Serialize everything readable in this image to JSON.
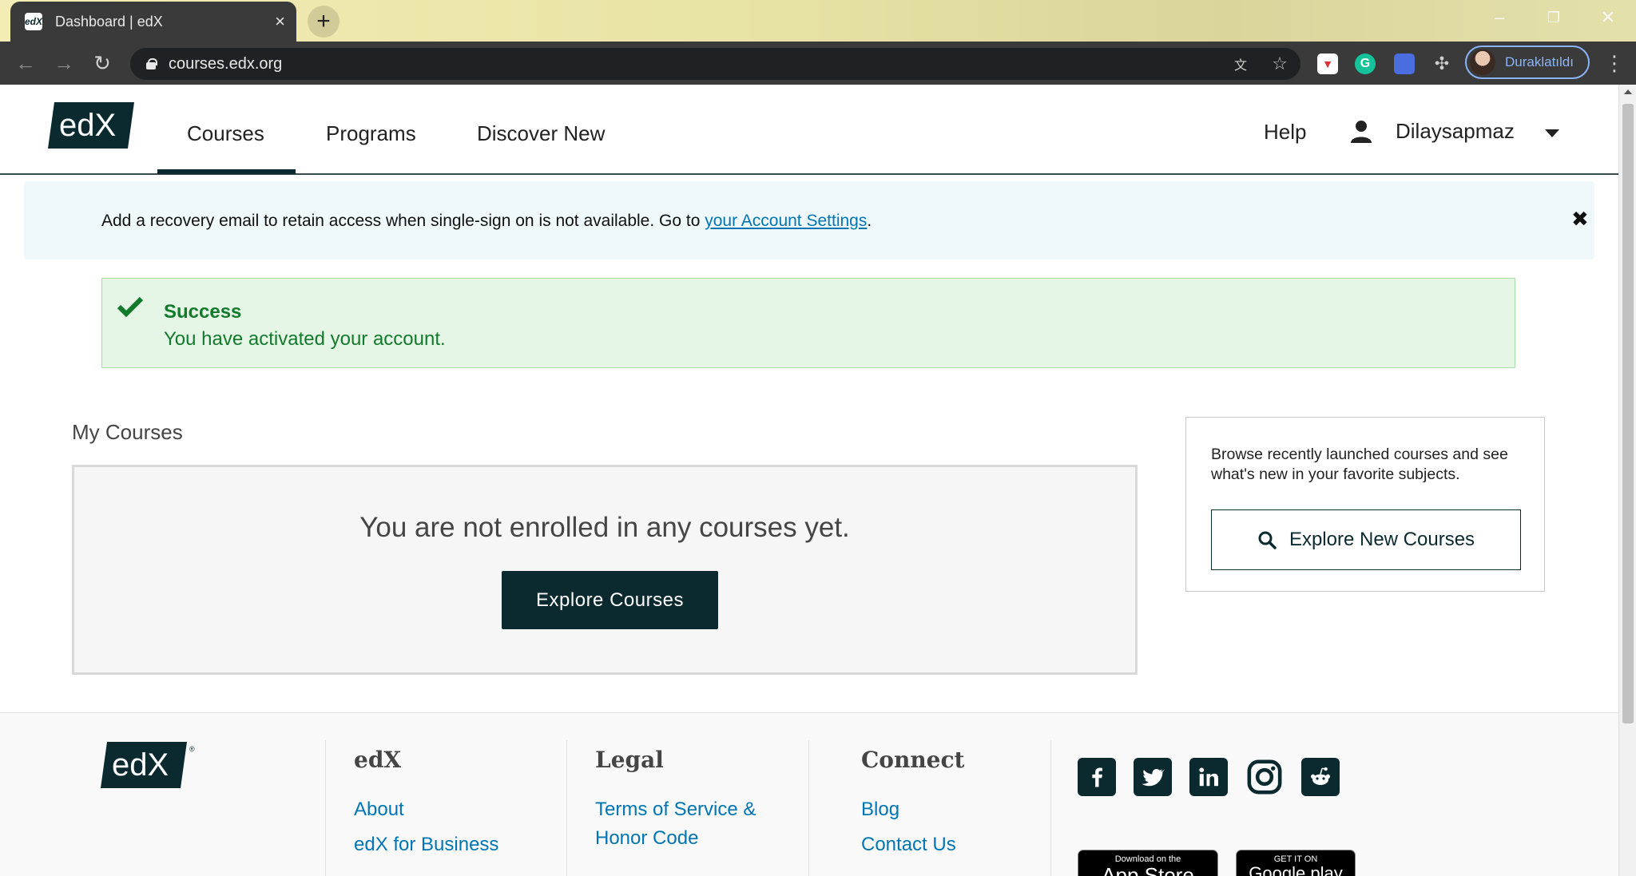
{
  "browser": {
    "tab_title": "Dashboard | edX",
    "tab_favicon": "edX",
    "url": "courses.edx.org",
    "profile_label": "Duraklatıldı"
  },
  "header": {
    "logo_text": "edX",
    "nav": [
      "Courses",
      "Programs",
      "Discover New"
    ],
    "active_nav": "Courses",
    "help": "Help",
    "username": "Dilaysapmaz"
  },
  "notice": {
    "text": "Add a recovery email to retain access when single-sign on is not available. Go to ",
    "link": "your Account Settings",
    "suffix": "."
  },
  "success": {
    "title": "Success",
    "message": "You have activated your account."
  },
  "main": {
    "section_title": "My Courses",
    "empty_text": "You are not enrolled in any courses yet.",
    "explore_button": "Explore Courses"
  },
  "sidebar": {
    "text": "Browse recently launched courses and see what's new in your favorite subjects.",
    "button": "Explore New Courses"
  },
  "footer": {
    "logo_text": "edX",
    "logo_mark": "®",
    "columns": [
      {
        "heading": "edX",
        "links": [
          "About",
          "edX for Business"
        ]
      },
      {
        "heading": "Legal",
        "links": [
          "Terms of Service &",
          "Honor Code"
        ]
      },
      {
        "heading": "Connect",
        "links": [
          "Blog",
          "Contact Us"
        ]
      }
    ],
    "social": [
      "facebook-icon",
      "twitter-icon",
      "linkedin-icon",
      "instagram-icon",
      "reddit-icon"
    ],
    "stores": [
      {
        "small": "Download on the",
        "big": "App Store"
      },
      {
        "small": "GET IT ON",
        "big": "Google play"
      }
    ]
  },
  "colors": {
    "brand_dark": "#0b2a30",
    "link": "#0075b4",
    "success_green": "#117b2b",
    "success_bg": "#e6f6e6",
    "notice_bg": "#eff8fa"
  }
}
